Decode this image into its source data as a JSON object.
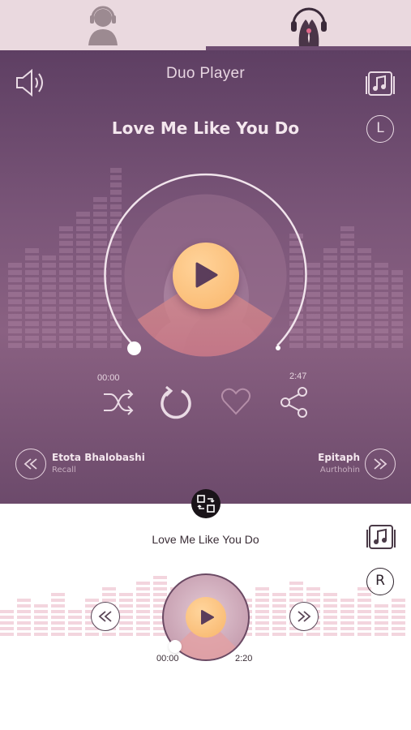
{
  "tabs": [
    {
      "name": "single-listener",
      "icon": "person-headphones-icon"
    },
    {
      "name": "duo-listener",
      "icon": "two-faces-headphones-icon",
      "active": true
    }
  ],
  "header": {
    "app_title": "Duo Player",
    "volume_icon": "speaker-icon",
    "playlist_icon": "music-library-icon"
  },
  "left_player": {
    "channel_label": "L",
    "song_title": "Love Me Like You Do",
    "elapsed": "00:00",
    "duration": "2:47",
    "progress": 0.0,
    "controls": [
      "shuffle-icon",
      "repeat-icon",
      "heart-icon",
      "share-icon"
    ],
    "previous_track": {
      "title": "Etota Bhalobashi",
      "artist": "Recall"
    },
    "next_track": {
      "title": "Epitaph",
      "artist": "Aurthohin"
    }
  },
  "bottom_player": {
    "channel_label": "R",
    "song_title": "Love Me Like You Do",
    "elapsed": "00:00",
    "duration": "2:20",
    "progress": 0.0
  },
  "colors": {
    "panel_top": "#5e3f63",
    "panel_mid": "#8a6182",
    "accent_play": "#f9b66b",
    "tab_bg": "#ead9df",
    "active_tab_indicator": "#6f4d72"
  }
}
